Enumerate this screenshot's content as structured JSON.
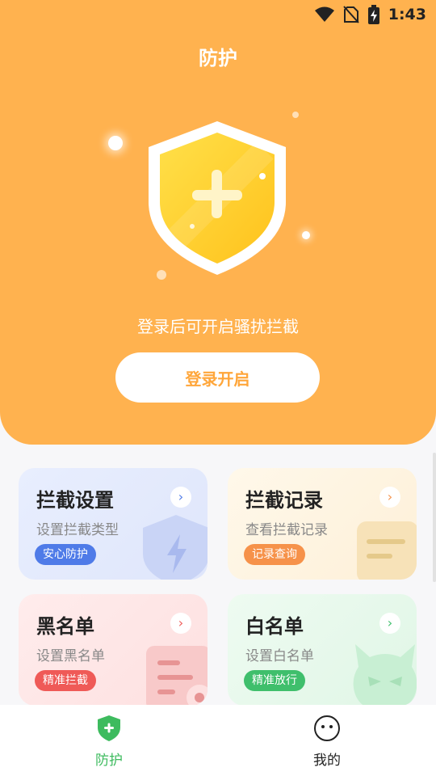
{
  "status_bar": {
    "time": "1:43",
    "icons": [
      "wifi-icon",
      "no-sim-icon",
      "battery-charging-icon"
    ]
  },
  "header": {
    "title": "防护",
    "hint": "登录后可开启骚扰拦截",
    "login_button": "登录开启"
  },
  "cards": [
    {
      "title": "拦截设置",
      "subtitle": "设置拦截类型",
      "tag": "安心防护",
      "tag_color": "#4f7be8",
      "icon": "lightning-shield-icon"
    },
    {
      "title": "拦截记录",
      "subtitle": "查看拦截记录",
      "tag": "记录查询",
      "tag_color": "#f6924a",
      "icon": "document-icon"
    },
    {
      "title": "黑名单",
      "subtitle": "设置黑名单",
      "tag": "精准拦截",
      "tag_color": "#ef5a57",
      "icon": "list-user-icon"
    },
    {
      "title": "白名单",
      "subtitle": "设置白名单",
      "tag": "精准放行",
      "tag_color": "#3fbf6c",
      "icon": "devil-face-icon"
    }
  ],
  "bottom_nav": {
    "items": [
      {
        "label": "防护",
        "icon": "shield-plus-icon",
        "active": true
      },
      {
        "label": "我的",
        "icon": "face-icon",
        "active": false
      }
    ],
    "active_color": "#3dbb5e"
  },
  "colors": {
    "accent": "#ffb24f",
    "button_text": "#ffa63a"
  }
}
